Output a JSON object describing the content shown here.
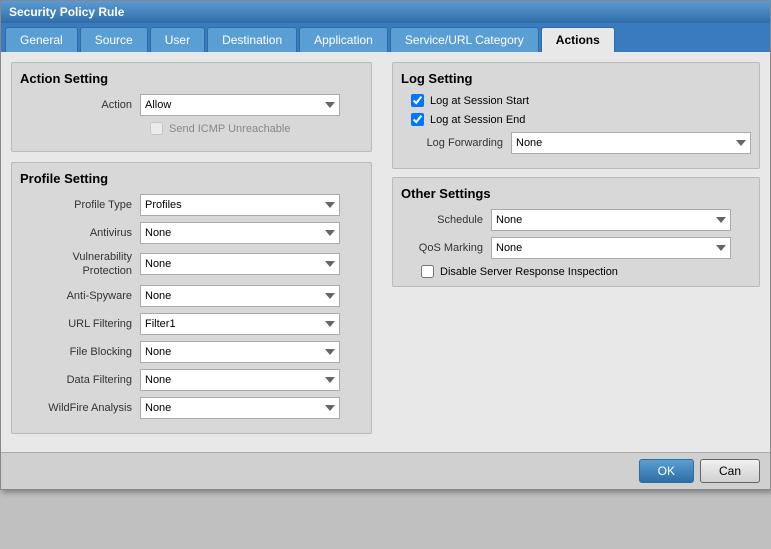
{
  "dialog": {
    "title": "Security Policy Rule"
  },
  "tabs": [
    {
      "label": "General",
      "active": false
    },
    {
      "label": "Source",
      "active": false
    },
    {
      "label": "User",
      "active": false
    },
    {
      "label": "Destination",
      "active": false
    },
    {
      "label": "Application",
      "active": false
    },
    {
      "label": "Service/URL Category",
      "active": false
    },
    {
      "label": "Actions",
      "active": true
    }
  ],
  "action_setting": {
    "title": "Action Setting",
    "action_label": "Action",
    "action_value": "Allow",
    "send_icmp_label": "Send ICMP Unreachable",
    "send_icmp_disabled": true
  },
  "profile_setting": {
    "title": "Profile Setting",
    "profile_type_label": "Profile Type",
    "profile_type_value": "Profiles",
    "antivirus_label": "Antivirus",
    "antivirus_value": "None",
    "vuln_label": "Vulnerability Protection",
    "vuln_value": "None",
    "anti_spyware_label": "Anti-Spyware",
    "anti_spyware_value": "None",
    "url_filtering_label": "URL Filtering",
    "url_filtering_value": "Filter1",
    "file_blocking_label": "File Blocking",
    "file_blocking_value": "None",
    "data_filtering_label": "Data Filtering",
    "data_filtering_value": "None",
    "wildfire_label": "WildFire Analysis",
    "wildfire_value": "None"
  },
  "log_setting": {
    "title": "Log Setting",
    "log_session_start_label": "Log at Session Start",
    "log_session_start_checked": true,
    "log_session_end_label": "Log at Session End",
    "log_session_end_checked": true,
    "log_forwarding_label": "Log Forwarding",
    "log_forwarding_value": "None"
  },
  "other_settings": {
    "title": "Other Settings",
    "schedule_label": "Schedule",
    "schedule_value": "None",
    "qos_label": "QoS Marking",
    "qos_value": "None",
    "disable_server_label": "Disable Server Response Inspection"
  },
  "footer": {
    "ok_label": "OK",
    "cancel_label": "Can"
  }
}
